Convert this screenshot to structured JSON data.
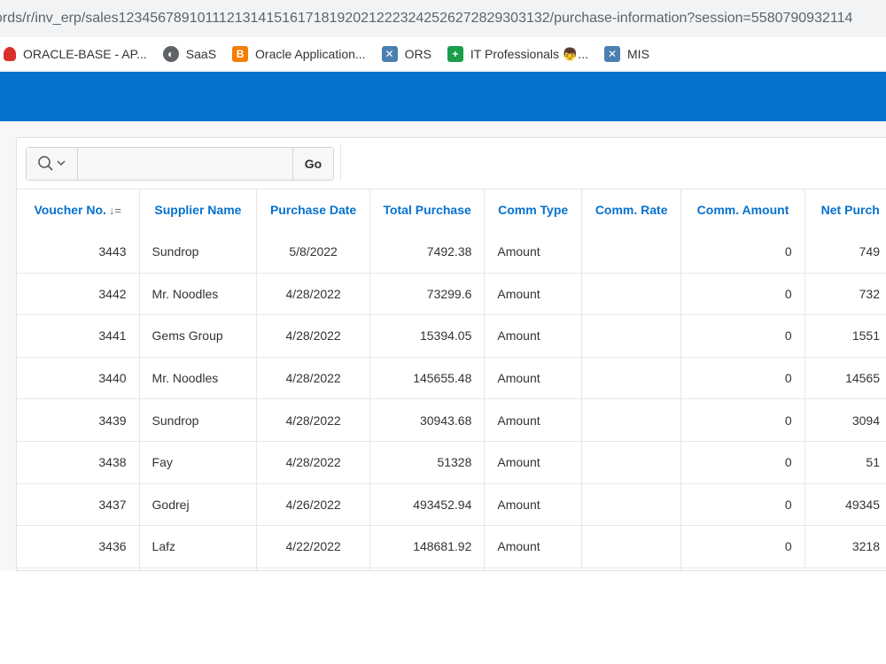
{
  "browser": {
    "url": "ords/r/inv_erp/sales1234567891011121314151617181920212223242526272829303132/purchase-information?session=5580790932114",
    "bookmarks": [
      {
        "label": "ORACLE-BASE - AP...",
        "icon": "oracle-icon"
      },
      {
        "label": "SaaS",
        "icon": "globe-icon"
      },
      {
        "label": "Oracle Application...",
        "icon": "blogger-icon"
      },
      {
        "label": "ORS",
        "icon": "x-app-icon"
      },
      {
        "label": "IT Professionals 👦...",
        "icon": "plus-icon"
      },
      {
        "label": "MIS",
        "icon": "x-app-icon"
      }
    ]
  },
  "colors": {
    "header_band": "#0572ce",
    "column_header": "#0572ce"
  },
  "toolbar": {
    "search_placeholder": "",
    "go_label": "Go"
  },
  "table": {
    "columns": [
      "Voucher No.",
      "Supplier Name",
      "Purchase Date",
      "Total Purchase",
      "Comm Type",
      "Comm. Rate",
      "Comm. Amount",
      "Net Purch"
    ],
    "rows": [
      {
        "voucher": "3443",
        "supplier": "Sundrop",
        "date": "5/8/2022",
        "total": "7492.38",
        "comm_type": "Amount",
        "rate": "",
        "comm_amount": "0",
        "net": "749"
      },
      {
        "voucher": "3442",
        "supplier": "Mr. Noodles",
        "date": "4/28/2022",
        "total": "73299.6",
        "comm_type": "Amount",
        "rate": "",
        "comm_amount": "0",
        "net": "732"
      },
      {
        "voucher": "3441",
        "supplier": "Gems Group",
        "date": "4/28/2022",
        "total": "15394.05",
        "comm_type": "Amount",
        "rate": "",
        "comm_amount": "0",
        "net": "1551"
      },
      {
        "voucher": "3440",
        "supplier": "Mr. Noodles",
        "date": "4/28/2022",
        "total": "145655.48",
        "comm_type": "Amount",
        "rate": "",
        "comm_amount": "0",
        "net": "14565"
      },
      {
        "voucher": "3439",
        "supplier": "Sundrop",
        "date": "4/28/2022",
        "total": "30943.68",
        "comm_type": "Amount",
        "rate": "",
        "comm_amount": "0",
        "net": "3094"
      },
      {
        "voucher": "3438",
        "supplier": "Fay",
        "date": "4/28/2022",
        "total": "51328",
        "comm_type": "Amount",
        "rate": "",
        "comm_amount": "0",
        "net": "51"
      },
      {
        "voucher": "3437",
        "supplier": "Godrej",
        "date": "4/26/2022",
        "total": "493452.94",
        "comm_type": "Amount",
        "rate": "",
        "comm_amount": "0",
        "net": "49345"
      },
      {
        "voucher": "3436",
        "supplier": "Lafz",
        "date": "4/22/2022",
        "total": "148681.92",
        "comm_type": "Amount",
        "rate": "",
        "comm_amount": "0",
        "net": "3218"
      }
    ]
  }
}
